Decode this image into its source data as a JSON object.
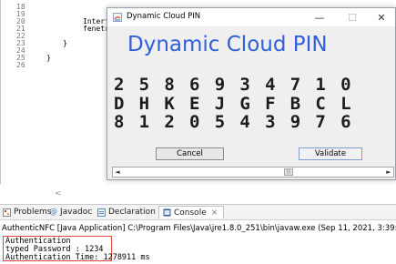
{
  "editor": {
    "line_numbers": [
      "18",
      "19",
      "20",
      "21",
      "22",
      "23",
      "24",
      "25",
      "26"
    ],
    "code_lines": [
      {
        "text": "",
        "indent": 0
      },
      {
        "text": "",
        "indent": 0
      },
      {
        "text": "Interf",
        "indent": 3
      },
      {
        "text": "fenetr",
        "indent": 3
      },
      {
        "text": "",
        "indent": 0
      },
      {
        "text": "}",
        "indent": 2
      },
      {
        "text": "",
        "indent": 0
      },
      {
        "text": "}",
        "indent": 1
      },
      {
        "text": "",
        "indent": 0
      }
    ],
    "scroll_left_glyph": "<"
  },
  "dialog": {
    "title": "Dynamic Cloud PIN",
    "heading": "Dynamic Cloud PIN",
    "minimize": "—",
    "maximize": "☐",
    "close": "✕",
    "pin_rows": [
      "2 5 8 6 9 3 4 7 1 0",
      "D H K E J G F B C L",
      "8 1 2 0 5 4 3 9 7 6"
    ],
    "cancel_label": "Cancel",
    "validate_label": "Validate",
    "scroll_left": "◄",
    "scroll_right": "►"
  },
  "panel": {
    "tabs": [
      {
        "label": "Problems",
        "icon": "problems-icon",
        "color": "#c0392b"
      },
      {
        "label": "Javadoc",
        "icon": "javadoc-icon",
        "color": "#4a7fbf"
      },
      {
        "label": "Declaration",
        "icon": "declaration-icon",
        "color": "#5a8fd0"
      },
      {
        "label": "Console",
        "icon": "console-icon",
        "color": "#2f5f9a"
      }
    ],
    "console_close": "⨯",
    "launch_line": "AuthenticNFC [Java Application] C:\\Program Files\\Java\\jre1.8.0_251\\bin\\javaw.exe (Sep 11, 2021, 3:39:4",
    "output_lines": [
      "Authentication",
      "typed Password : 1234",
      "Authentication Time: 1278911 ms"
    ],
    "highlight_color": "#e0463e"
  }
}
